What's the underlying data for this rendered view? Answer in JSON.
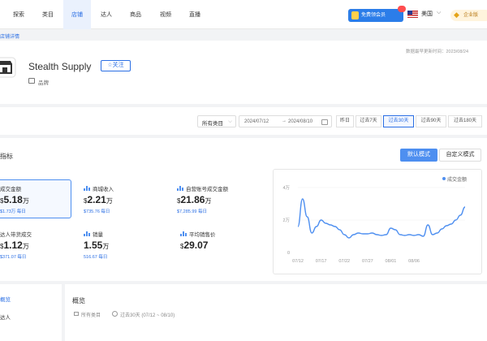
{
  "nav": {
    "tabs": [
      {
        "label": "探索"
      },
      {
        "label": "类目"
      },
      {
        "label": "店铺"
      },
      {
        "label": "达人"
      },
      {
        "label": "商品"
      },
      {
        "label": "视频"
      },
      {
        "label": "直播"
      }
    ],
    "active_tab": "店铺",
    "free_trial_label": "免费领会员",
    "country": "美国",
    "enterprise_label": "企业版"
  },
  "breadcrumb": "店铺详情",
  "store": {
    "update_info": "数据最早更新时间：2023/08/24",
    "name": "Stealth Supply",
    "follow_label": "☆关注",
    "category_tag": "品牌"
  },
  "filters": {
    "category": "所有类目",
    "date_start": "2024/07/12",
    "date_sep": "→",
    "date_end": "2024/08/10",
    "ranges": [
      {
        "label": "昨日"
      },
      {
        "label": "过去7天"
      },
      {
        "label": "过去30天"
      },
      {
        "label": "过去90天"
      },
      {
        "label": "过去180天"
      }
    ],
    "active_range": "过去30天"
  },
  "metrics": {
    "title": "指标",
    "mode_default": "默认模式",
    "mode_custom": "自定义模式",
    "kpis": [
      {
        "label": "成交金额",
        "currency": "$",
        "value": "5.18",
        "unit": "万",
        "sub": "$1.73万 每日",
        "selected": true
      },
      {
        "label": "商城收入",
        "currency": "$",
        "value": "2.21",
        "unit": "万",
        "sub": "$735.76 每日",
        "selected": false
      },
      {
        "label": "自营账号成交金额",
        "currency": "$",
        "value": "21.86",
        "unit": "万",
        "sub": "$7,285.99 每日",
        "selected": false
      },
      {
        "label": "达人带货成交",
        "currency": "$",
        "value": "1.12",
        "unit": "万",
        "sub": "$371.07 每日",
        "selected": false
      },
      {
        "label": "销量",
        "currency": "",
        "value": "1.55",
        "unit": "万",
        "sub": "516.67 每日",
        "selected": false
      },
      {
        "label": "平均销售价",
        "currency": "$",
        "value": "29.07",
        "unit": "",
        "sub": "",
        "selected": false
      }
    ]
  },
  "chart_data": {
    "type": "line",
    "series": [
      {
        "name": "成交金额",
        "values": [
          1.6,
          3.3,
          2.2,
          1.2,
          1.6,
          2.0,
          1.8,
          1.7,
          1.6,
          1.4,
          1.1,
          0.9,
          1.1,
          1.2,
          1.15,
          1.15,
          1.2,
          1.1,
          1.05,
          1.1,
          1.5,
          1.4,
          1.1,
          1.05,
          1.1,
          1.05,
          1.1,
          1.0,
          1.7,
          1.1,
          1.2,
          1.45,
          1.65,
          1.75,
          2.0,
          2.3,
          2.8
        ]
      },
      {
        "name": "",
        "values": []
      }
    ],
    "x_ticks": [
      "07/12",
      "07/17",
      "07/22",
      "07/27",
      "08/01",
      "08/06"
    ],
    "y_ticks": [
      "0",
      "2万",
      "4万"
    ],
    "ylim": [
      0,
      4
    ],
    "xlabel": "",
    "ylabel": "",
    "line_color": "#4e8ff0"
  },
  "bottom": {
    "left_items": [
      {
        "label": "概览",
        "active": true
      },
      {
        "label": "达人",
        "active": false
      }
    ],
    "overview_title": "概览",
    "category": "所有类目",
    "range": "过去30天 (07/12 ~ 08/10)"
  }
}
